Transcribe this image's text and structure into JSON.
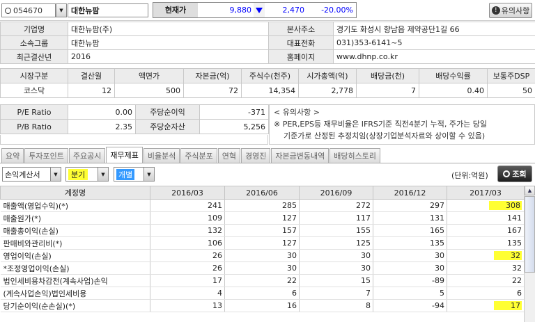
{
  "header": {
    "code": "054670",
    "name": "대한뉴팜",
    "price_label": "현재가",
    "price": "9,880",
    "change": "2,470",
    "change_pct": "-20.00%",
    "notice_label": "유의사항",
    "down_color": "#0000ff"
  },
  "company": {
    "rows": [
      [
        "기업명",
        "대한뉴팜(주)",
        "본사주소",
        "경기도 화성시 향남읍 제약공단1길 66"
      ],
      [
        "소속그룹",
        "대한뉴팜",
        "대표전화",
        "031)353-6141~5"
      ],
      [
        "최근결산년",
        "2016",
        "홈페이지",
        "www.dhnp.co.kr"
      ]
    ]
  },
  "market": {
    "headers": [
      "시장구분",
      "결산월",
      "액면가",
      "자본금(억)",
      "주식수(천주)",
      "시가총액(억)",
      "배당금(천)",
      "배당수익률",
      "보통주DSP"
    ],
    "values": [
      "코스닥",
      "12",
      "500",
      "72",
      "14,354",
      "2,778",
      "7",
      "0.40",
      "50"
    ]
  },
  "ratios": {
    "rows": [
      [
        "P/E Ratio",
        "0.00",
        "주당순이익",
        "-371"
      ],
      [
        "P/B Ratio",
        "2.35",
        "주당순자산",
        "5,256"
      ]
    ]
  },
  "notice": {
    "title": "< 유의사항 >",
    "line1": "※ PER,EPS등 재무비율은 IFRS기준 직전4분기 누적, 주가는 당일",
    "line2": "기준가로 산정된 추정치임(상장기업분석자료와 상이할 수 있음)"
  },
  "tabs": [
    "요약",
    "투자포인트",
    "주요공시",
    "재무제표",
    "비율분석",
    "주식분포",
    "연혁",
    "경영진",
    "자본금변동내역",
    "배당히스토리"
  ],
  "filters": {
    "statement": "손익계산서",
    "period": "분기",
    "scope": "개별",
    "unit": "(단위:억원)",
    "search": "조회"
  },
  "fin": {
    "headers": [
      "계정명",
      "2016/03",
      "2016/06",
      "2016/09",
      "2016/12",
      "2017/03"
    ],
    "rows": [
      [
        "매출액(영업수익)(*)",
        "241",
        "285",
        "272",
        "297",
        "308"
      ],
      [
        "매출원가(*)",
        "109",
        "127",
        "117",
        "131",
        "141"
      ],
      [
        "매출총이익(손실)",
        "132",
        "157",
        "155",
        "165",
        "167"
      ],
      [
        "판매비와관리비(*)",
        "106",
        "127",
        "125",
        "135",
        "135"
      ],
      [
        "영업이익(손실)",
        "26",
        "30",
        "30",
        "30",
        "32"
      ],
      [
        "*조정영업이익(손실)",
        "26",
        "30",
        "30",
        "30",
        "32"
      ],
      [
        "법인세비용차감전(계속사업)손익",
        "17",
        "22",
        "15",
        "-89",
        "22"
      ],
      [
        "(계속사업손익)법인세비용",
        "4",
        "6",
        "7",
        "5",
        "6"
      ],
      [
        "당기순이익(순손실)(*)",
        "13",
        "16",
        "8",
        "-94",
        "17"
      ]
    ]
  }
}
